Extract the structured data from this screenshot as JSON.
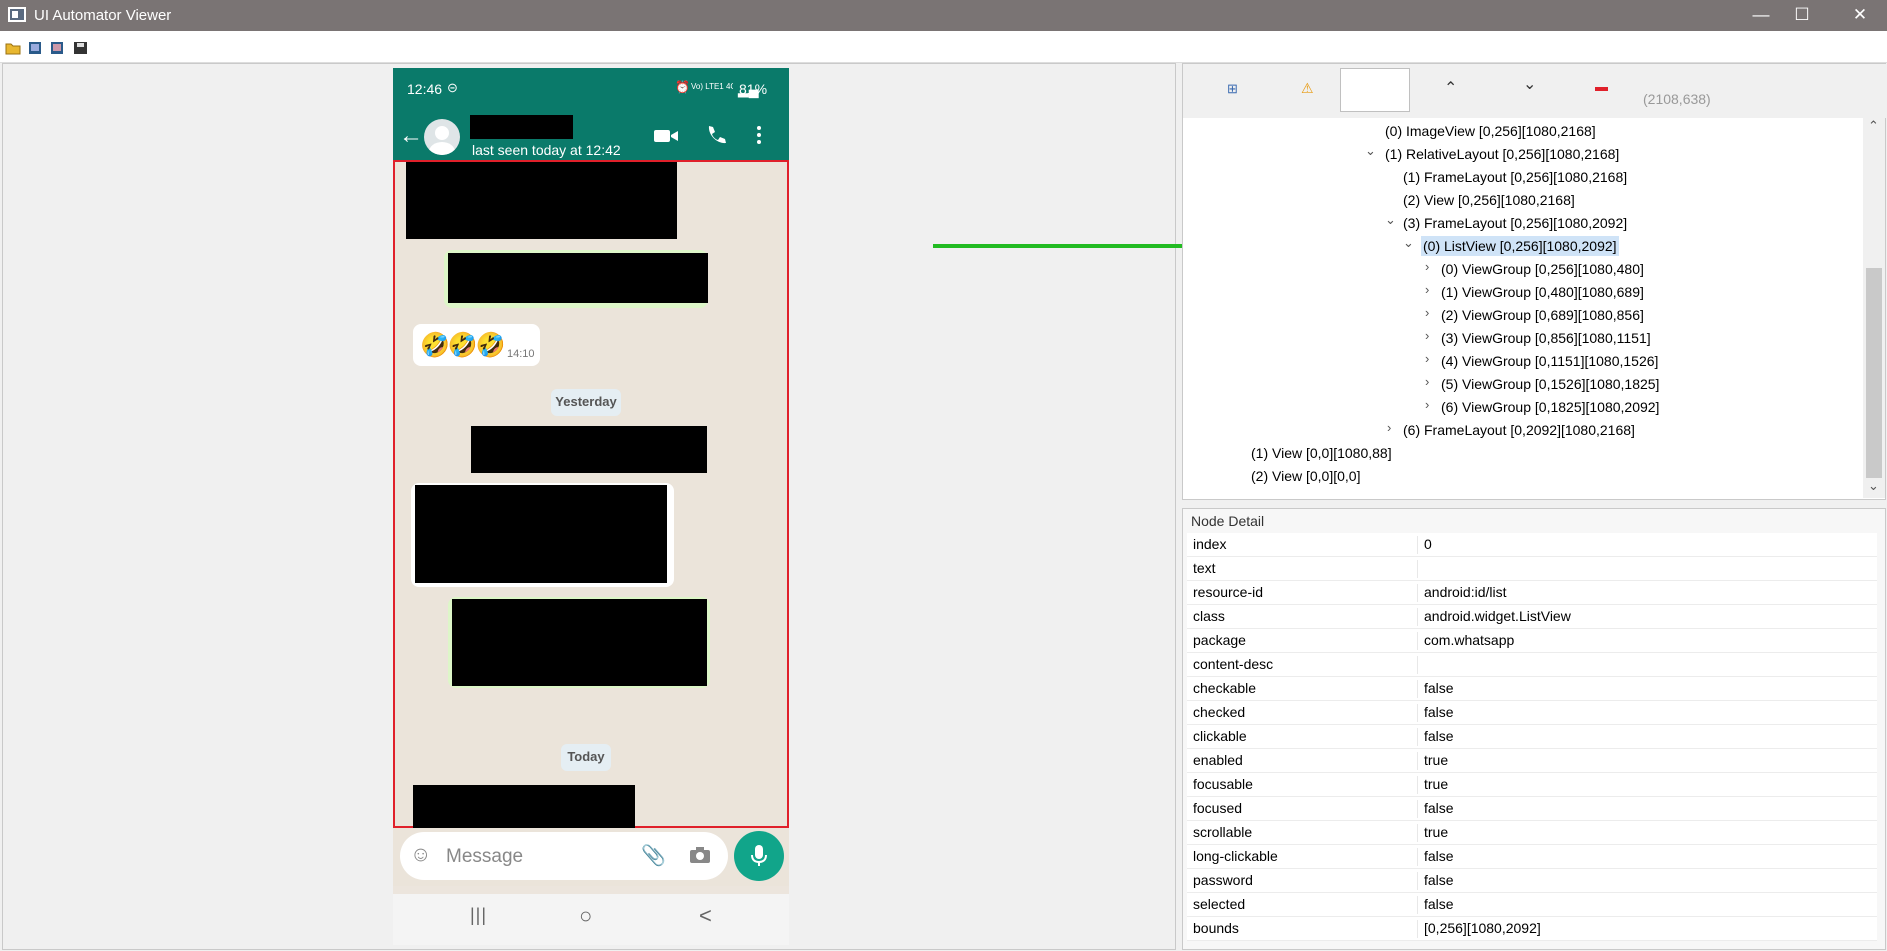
{
  "window": {
    "title": "UI Automator Viewer",
    "minimize": "—",
    "maximize": "☐",
    "close": "✕"
  },
  "toolbar": {
    "items": [
      "open-icon",
      "device-screenshot-icon",
      "device-screenshot-compressed-icon",
      "save-icon"
    ]
  },
  "phone": {
    "status": {
      "time": "12:46",
      "network": "Vo) LTE1 4G+",
      "battery": "81%"
    },
    "chat": {
      "last_seen": "last seen today at 12:42"
    },
    "messages": {
      "emoji": "🤣🤣🤣",
      "emoji_time": "14:10",
      "date1": "Yesterday",
      "date2": "Today"
    },
    "input": {
      "placeholder": "Message"
    },
    "nav": {
      "recent": "|||",
      "home": "○",
      "back": "<"
    }
  },
  "inspector": {
    "coords": "(2108,638)",
    "tree": [
      {
        "label": "(0) ImageView [0,256][1080,2168]"
      },
      {
        "label": "(1) RelativeLayout [0,256][1080,2168]",
        "expanded": true
      },
      {
        "label": "(1) FrameLayout [0,256][1080,2168]"
      },
      {
        "label": "(2) View [0,256][1080,2168]"
      },
      {
        "label": "(3) FrameLayout [0,256][1080,2092]",
        "expanded": true
      },
      {
        "label": "(0) ListView [0,256][1080,2092]",
        "expanded": true,
        "selected": true
      },
      {
        "label": "(0) ViewGroup [0,256][1080,480]",
        "collapsed": true
      },
      {
        "label": "(1) ViewGroup [0,480][1080,689]",
        "collapsed": true
      },
      {
        "label": "(2) ViewGroup [0,689][1080,856]",
        "collapsed": true
      },
      {
        "label": "(3) ViewGroup [0,856][1080,1151]",
        "collapsed": true
      },
      {
        "label": "(4) ViewGroup [0,1151][1080,1526]",
        "collapsed": true
      },
      {
        "label": "(5) ViewGroup [0,1526][1080,1825]",
        "collapsed": true
      },
      {
        "label": "(6) ViewGroup [0,1825][1080,2092]",
        "collapsed": true
      },
      {
        "label": "(6) FrameLayout [0,2092][1080,2168]",
        "collapsed": true
      },
      {
        "label": "(1) View [0,0][1080,88]"
      },
      {
        "label": "(2) View [0,0][0,0]"
      }
    ],
    "node_detail": {
      "title": "Node Detail",
      "rows": [
        {
          "k": "index",
          "v": "0"
        },
        {
          "k": "text",
          "v": ""
        },
        {
          "k": "resource-id",
          "v": "android:id/list"
        },
        {
          "k": "class",
          "v": "android.widget.ListView"
        },
        {
          "k": "package",
          "v": "com.whatsapp"
        },
        {
          "k": "content-desc",
          "v": ""
        },
        {
          "k": "checkable",
          "v": "false"
        },
        {
          "k": "checked",
          "v": "false"
        },
        {
          "k": "clickable",
          "v": "false"
        },
        {
          "k": "enabled",
          "v": "true"
        },
        {
          "k": "focusable",
          "v": "true"
        },
        {
          "k": "focused",
          "v": "false"
        },
        {
          "k": "scrollable",
          "v": "true"
        },
        {
          "k": "long-clickable",
          "v": "false"
        },
        {
          "k": "password",
          "v": "false"
        },
        {
          "k": "selected",
          "v": "false"
        },
        {
          "k": "bounds",
          "v": "[0,256][1080,2092]"
        }
      ]
    }
  },
  "colors": {
    "whatsapp_green": "#0a7a6a",
    "selection_border": "#e0202a",
    "arrow": "#22bb22",
    "mic_button": "#11a58a"
  }
}
